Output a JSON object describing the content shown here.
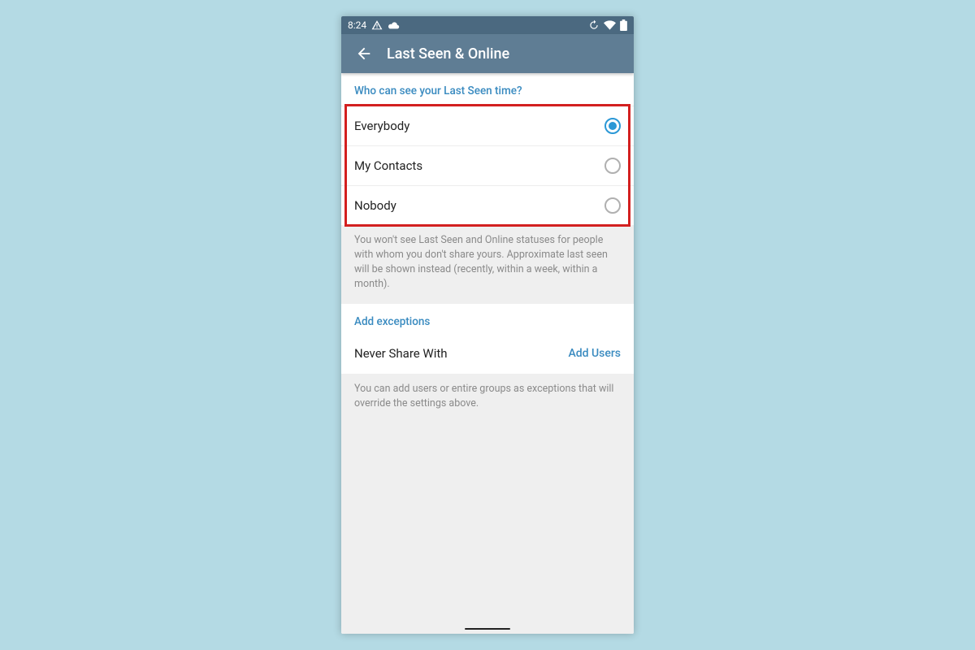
{
  "status": {
    "time": "8:24"
  },
  "appbar": {
    "title": "Last Seen & Online"
  },
  "section1": {
    "header": "Who can see your Last Seen time?",
    "options": [
      {
        "label": "Everybody",
        "selected": true
      },
      {
        "label": "My Contacts",
        "selected": false
      },
      {
        "label": "Nobody",
        "selected": false
      }
    ],
    "help": "You won't see Last Seen and Online statuses for people with whom you don't share yours. Approximate last seen will be shown instead (recently, within a week, within a month)."
  },
  "section2": {
    "header": "Add exceptions",
    "row_label": "Never Share With",
    "row_action": "Add Users",
    "help": "You can add users or entire groups as exceptions that will override the settings above."
  },
  "colors": {
    "accent": "#3a8bc0",
    "appbar": "#5f7d94",
    "statusbar": "#4b6980",
    "highlight": "#d32020"
  }
}
